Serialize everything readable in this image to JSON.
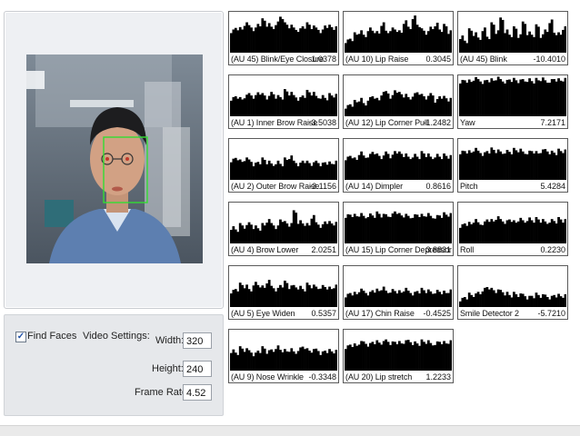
{
  "settings": {
    "find_faces_label": "Find Faces",
    "find_faces_checked": true,
    "video_settings_label": "Video Settings:",
    "width_label": "Width:",
    "width_value": "320",
    "height_label": "Height:",
    "height_value": "240",
    "frame_rate_label": "Frame Rate:",
    "frame_rate_value": "4.52"
  },
  "charts": [
    {
      "label": "(AU 45) Blink/Eye Closure",
      "value": "1.0378",
      "levels": [
        0.55,
        0.62,
        0.58,
        0.7,
        0.66,
        0.6,
        0.72,
        0.8,
        0.68,
        0.62,
        0.75,
        0.9,
        0.7,
        0.64,
        0.6,
        0.58,
        0.66,
        0.7,
        0.62,
        0.6,
        0.55,
        0.68,
        0.64,
        0.6
      ]
    },
    {
      "label": "(AU 10) Lip Raise",
      "value": "0.3045",
      "levels": [
        0.3,
        0.35,
        0.45,
        0.5,
        0.42,
        0.6,
        0.55,
        0.48,
        0.7,
        0.52,
        0.6,
        0.58,
        0.5,
        0.75,
        0.62,
        0.9,
        0.7,
        0.55,
        0.48,
        0.62,
        0.72,
        0.58,
        0.66,
        0.5
      ]
    },
    {
      "label": "(AU 45) Blink",
      "value": "-10.4010",
      "levels": [
        0.4,
        0.3,
        0.55,
        0.45,
        0.35,
        0.6,
        0.4,
        0.7,
        0.5,
        0.85,
        0.55,
        0.45,
        0.6,
        0.4,
        0.75,
        0.5,
        0.45,
        0.65,
        0.4,
        0.55,
        0.8,
        0.5,
        0.45,
        0.6
      ]
    },
    {
      "label": "(AU 1) Inner Brow Raise",
      "value": "-3.5038",
      "levels": [
        0.45,
        0.5,
        0.42,
        0.48,
        0.55,
        0.5,
        0.6,
        0.52,
        0.45,
        0.58,
        0.5,
        0.48,
        0.62,
        0.55,
        0.5,
        0.45,
        0.52,
        0.6,
        0.55,
        0.48,
        0.5,
        0.46,
        0.52,
        0.5
      ]
    },
    {
      "label": "(AU 12) Lip Corner Pull",
      "value": "-1.2482",
      "levels": [
        0.25,
        0.3,
        0.35,
        0.4,
        0.3,
        0.45,
        0.5,
        0.4,
        0.55,
        0.6,
        0.5,
        0.65,
        0.55,
        0.5,
        0.45,
        0.55,
        0.6,
        0.5,
        0.45,
        0.55,
        0.4,
        0.5,
        0.45,
        0.4
      ]
    },
    {
      "label": "Yaw",
      "value": "7.2171",
      "levels": [
        0.88,
        0.9,
        0.86,
        0.92,
        0.9,
        0.87,
        0.91,
        0.89,
        0.93,
        0.9,
        0.88,
        0.92,
        0.9,
        0.86,
        0.9,
        0.92,
        0.88,
        0.9,
        0.91,
        0.87,
        0.9,
        0.93,
        0.89,
        0.9
      ]
    },
    {
      "label": "(AU 2) Outer Brow Raise",
      "value": "-3.1156",
      "levels": [
        0.5,
        0.55,
        0.45,
        0.5,
        0.48,
        0.4,
        0.45,
        0.5,
        0.42,
        0.38,
        0.45,
        0.4,
        0.5,
        0.55,
        0.45,
        0.4,
        0.48,
        0.42,
        0.38,
        0.45,
        0.4,
        0.44,
        0.4,
        0.42
      ]
    },
    {
      "label": "(AU 14) Dimpler",
      "value": "0.8616",
      "levels": [
        0.55,
        0.6,
        0.5,
        0.65,
        0.58,
        0.62,
        0.7,
        0.6,
        0.55,
        0.68,
        0.6,
        0.72,
        0.65,
        0.6,
        0.55,
        0.62,
        0.58,
        0.66,
        0.6,
        0.55,
        0.62,
        0.58,
        0.6,
        0.56
      ]
    },
    {
      "label": "Pitch",
      "value": "5.4284",
      "levels": [
        0.7,
        0.72,
        0.68,
        0.74,
        0.7,
        0.66,
        0.72,
        0.75,
        0.7,
        0.68,
        0.72,
        0.7,
        0.74,
        0.72,
        0.68,
        0.7,
        0.72,
        0.66,
        0.7,
        0.74,
        0.7,
        0.68,
        0.72,
        0.7
      ]
    },
    {
      "label": "(AU 4) Brow Lower",
      "value": "2.0251",
      "levels": [
        0.4,
        0.35,
        0.45,
        0.4,
        0.5,
        0.42,
        0.38,
        0.45,
        0.55,
        0.48,
        0.42,
        0.6,
        0.5,
        0.45,
        0.8,
        0.55,
        0.5,
        0.45,
        0.65,
        0.5,
        0.45,
        0.55,
        0.5,
        0.48
      ]
    },
    {
      "label": "(AU 15) Lip Corner Depressor",
      "value": "3.8831",
      "levels": [
        0.7,
        0.72,
        0.68,
        0.7,
        0.66,
        0.72,
        0.7,
        0.74,
        0.68,
        0.7,
        0.72,
        0.8,
        0.7,
        0.68,
        0.66,
        0.7,
        0.72,
        0.68,
        0.7,
        0.66,
        0.68,
        0.7,
        0.72,
        0.7
      ]
    },
    {
      "label": "Roll",
      "value": "0.2230",
      "levels": [
        0.45,
        0.5,
        0.48,
        0.55,
        0.5,
        0.52,
        0.6,
        0.55,
        0.62,
        0.58,
        0.55,
        0.6,
        0.52,
        0.58,
        0.55,
        0.62,
        0.58,
        0.6,
        0.55,
        0.52,
        0.58,
        0.56,
        0.6,
        0.55
      ]
    },
    {
      "label": "(AU 5) Eye Widen",
      "value": "0.5357",
      "levels": [
        0.4,
        0.45,
        0.55,
        0.5,
        0.42,
        0.6,
        0.55,
        0.48,
        0.62,
        0.5,
        0.45,
        0.55,
        0.6,
        0.48,
        0.52,
        0.5,
        0.45,
        0.55,
        0.5,
        0.48,
        0.52,
        0.5,
        0.45,
        0.5
      ]
    },
    {
      "label": "(AU 17) Chin Raise",
      "value": "-0.4525",
      "levels": [
        0.3,
        0.35,
        0.32,
        0.4,
        0.38,
        0.35,
        0.42,
        0.4,
        0.45,
        0.38,
        0.42,
        0.4,
        0.36,
        0.42,
        0.38,
        0.35,
        0.4,
        0.42,
        0.38,
        0.36,
        0.4,
        0.38,
        0.35,
        0.38
      ]
    },
    {
      "label": "Smile Detector 2",
      "value": "-5.7210",
      "levels": [
        0.2,
        0.25,
        0.3,
        0.28,
        0.35,
        0.45,
        0.5,
        0.42,
        0.38,
        0.4,
        0.35,
        0.3,
        0.32,
        0.28,
        0.3,
        0.25,
        0.28,
        0.3,
        0.26,
        0.28,
        0.25,
        0.3,
        0.27,
        0.26
      ]
    },
    {
      "label": "(AU 9) Nose Wrinkle",
      "value": "-0.3348",
      "levels": [
        0.5,
        0.45,
        0.55,
        0.5,
        0.48,
        0.42,
        0.5,
        0.55,
        0.45,
        0.5,
        0.6,
        0.52,
        0.48,
        0.5,
        0.45,
        0.55,
        0.6,
        0.5,
        0.48,
        0.52,
        0.45,
        0.5,
        0.48,
        0.46
      ]
    },
    {
      "label": "(AU 20) Lip stretch",
      "value": "1.2233",
      "levels": [
        0.6,
        0.65,
        0.62,
        0.68,
        0.7,
        0.66,
        0.72,
        0.7,
        0.68,
        0.75,
        0.7,
        0.72,
        0.68,
        0.7,
        0.74,
        0.7,
        0.68,
        0.72,
        0.7,
        0.66,
        0.7,
        0.72,
        0.68,
        0.7
      ]
    }
  ]
}
